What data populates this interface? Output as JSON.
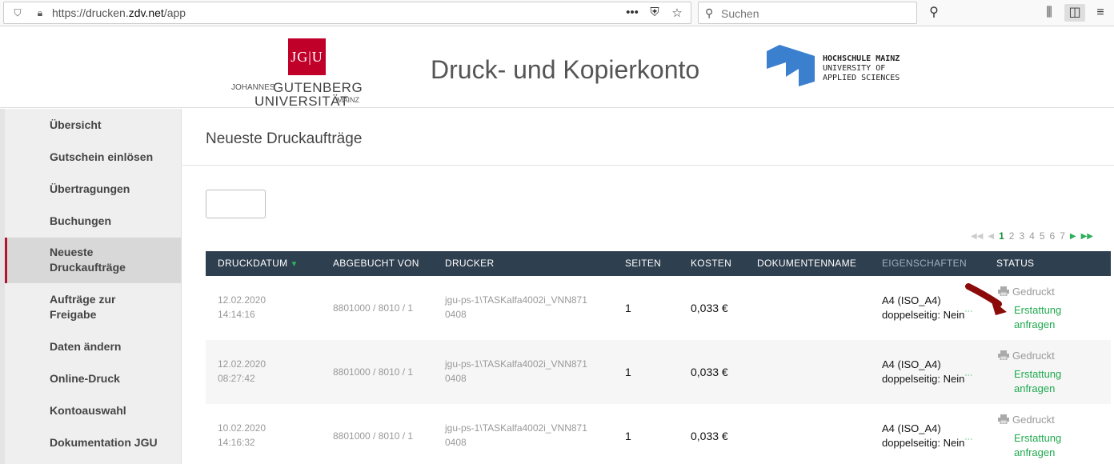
{
  "browser": {
    "url_prefix": "https://drucken.",
    "url_domain": "zdv.net",
    "url_path": "/app",
    "search_placeholder": "Suchen"
  },
  "header": {
    "jgu_mark": "JG|U",
    "jgu_small": "JOHANNES",
    "jgu_line1": "GUTENBERG",
    "jgu_line2": "UNIVERSITÄT",
    "jgu_mainz": "MAINZ",
    "title": "Druck- und Kopierkonto",
    "hs_line1": "HOCHSCHULE MAINZ",
    "hs_line2": "UNIVERSITY OF",
    "hs_line3": "APPLIED SCIENCES"
  },
  "sidebar": {
    "items": [
      {
        "label": "Übersicht"
      },
      {
        "label": "Gutschein einlösen"
      },
      {
        "label": "Übertragungen"
      },
      {
        "label": "Buchungen"
      },
      {
        "label_1": "Neueste",
        "label_2": "Druckaufträge"
      },
      {
        "label_1": "Aufträge zur",
        "label_2": "Freigabe"
      },
      {
        "label": "Daten ändern"
      },
      {
        "label": "Online-Druck"
      },
      {
        "label": "Kontoauswahl"
      },
      {
        "label": "Dokumentation JGU"
      }
    ]
  },
  "main": {
    "title": "Neueste Druckaufträge",
    "pager": {
      "first": "◀◀",
      "prev": "◀",
      "pages": [
        "1",
        "2",
        "3",
        "4",
        "5",
        "6",
        "7"
      ],
      "next": "▶",
      "last": "▶▶"
    },
    "columns": {
      "date": "DRUCKDATUM",
      "account": "ABGEBUCHT VON",
      "printer": "DRUCKER",
      "pages": "SEITEN",
      "cost": "KOSTEN",
      "docname": "DOKUMENTENNAME",
      "props": "EIGENSCHAFTEN",
      "status": "STATUS"
    },
    "rows": [
      {
        "date": "12.02.2020",
        "time": "14:14:16",
        "account": "8801000 / 8010 / 1",
        "printer_1": "jgu-ps-1\\TASKalfa4002i_VNN871",
        "printer_2": "0408",
        "pages": "1",
        "cost": "0,033 €",
        "prop_1": "A4 (ISO_A4)",
        "prop_2": "doppelseitig: Nein",
        "status": "Gedruckt",
        "refund_1": "Erstattung",
        "refund_2": "anfragen"
      },
      {
        "date": "12.02.2020",
        "time": "08:27:42",
        "account": "8801000 / 8010 / 1",
        "printer_1": "jgu-ps-1\\TASKalfa4002i_VNN871",
        "printer_2": "0408",
        "pages": "1",
        "cost": "0,033 €",
        "prop_1": "A4 (ISO_A4)",
        "prop_2": "doppelseitig: Nein",
        "status": "Gedruckt",
        "refund_1": "Erstattung",
        "refund_2": "anfragen"
      },
      {
        "date": "10.02.2020",
        "time": "14:16:32",
        "account": "8801000 / 8010 / 1",
        "printer_1": "jgu-ps-1\\TASKalfa4002i_VNN871",
        "printer_2": "0408",
        "pages": "1",
        "cost": "0,033 €",
        "prop_1": "A4 (ISO_A4)",
        "prop_2": "doppelseitig: Nein",
        "status": "Gedruckt",
        "refund_1": "Erstattung",
        "refund_2": "anfragen"
      }
    ]
  },
  "colors": {
    "accent_green": "#1faa4f",
    "table_header": "#2e3f4f",
    "active_border": "#b3132e",
    "jgu_red": "#c1002a",
    "hs_blue": "#3b7fcf"
  }
}
